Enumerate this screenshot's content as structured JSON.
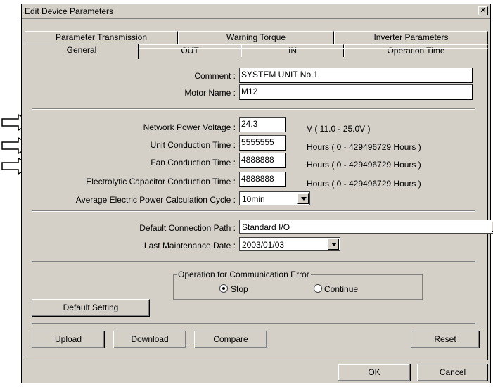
{
  "window": {
    "title": "Edit Device Parameters",
    "close_glyph": "✕"
  },
  "tabs_back": [
    "Parameter Transmission",
    "Warning Torque",
    "Inverter Parameters"
  ],
  "tabs_front": [
    "General",
    "OUT",
    "IN",
    "Operation Time"
  ],
  "general": {
    "comment_label": "Comment :",
    "comment_value": "SYSTEM UNIT No.1",
    "motor_label": "Motor Name :",
    "motor_value": "M12"
  },
  "params": {
    "voltage_label": "Network Power Voltage :",
    "voltage_value": "24.3",
    "voltage_unit": "V ( 11.0 - 25.0V )",
    "unit_time_label": "Unit Conduction Time :",
    "unit_time_value": "5555555",
    "unit_time_unit": "Hours ( 0 - 429496729 Hours )",
    "fan_label": "Fan Conduction Time :",
    "fan_value": "4888888",
    "fan_unit": "Hours ( 0 - 429496729 Hours )",
    "cap_label": "Electrolytic Capacitor Conduction Time :",
    "cap_value": "4888888",
    "cap_unit": "Hours ( 0 - 429496729 Hours )",
    "cycle_label": "Average Electric Power Calculation Cycle :",
    "cycle_value": "10min"
  },
  "connection": {
    "path_label": "Default Connection Path :",
    "path_value": "Standard I/O",
    "date_label": "Last Maintenance Date :",
    "date_value": "2003/01/03"
  },
  "comm_error": {
    "caption": "Operation for Communication Error",
    "stop_label": "Stop",
    "continue_label": "Continue",
    "selected": "Stop"
  },
  "buttons": {
    "default_setting": "Default Setting",
    "upload": "Upload",
    "download": "Download",
    "compare": "Compare",
    "reset": "Reset",
    "ok": "OK",
    "cancel": "Cancel"
  }
}
